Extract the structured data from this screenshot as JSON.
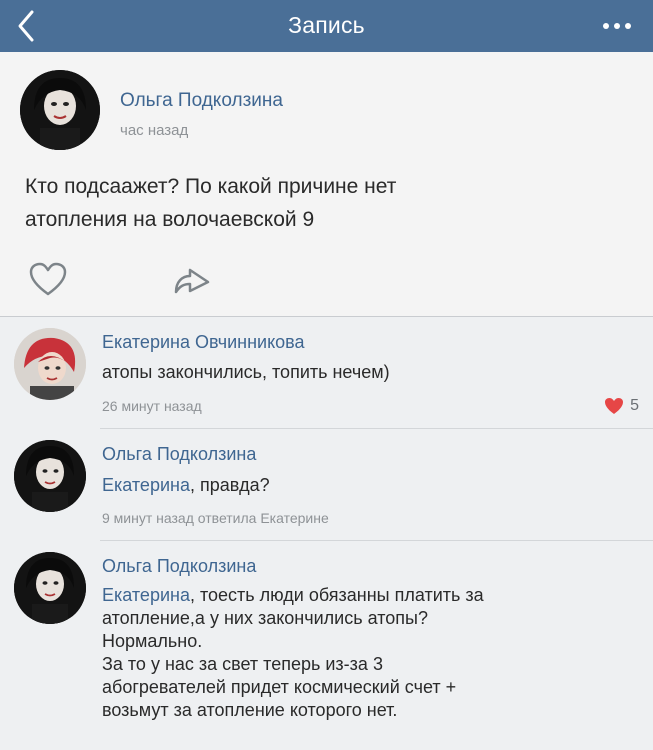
{
  "header": {
    "title": "Запись",
    "back_icon": "chevron-left-icon",
    "menu_icon": "more-horizontal-icon",
    "bar_color": "#4a6f97"
  },
  "post": {
    "author": "Ольга Подколзина",
    "time": "час назад",
    "text_line1": "Кто подсаажет? По какой причине нет",
    "text_line2": "атопления на волочаевской 9",
    "like_icon": "heart-outline-icon",
    "share_icon": "share-icon"
  },
  "comments": [
    {
      "author": "Екатерина Овчинникова",
      "text": "атопы закончились, топить нечем)",
      "time": "26 минут назад",
      "likes": "5",
      "like_color": "#e64646"
    },
    {
      "author": "Ольга Подколзина",
      "mention": "Екатерина",
      "text": ", правда?",
      "time": "9 минут назад ответила Екатерине"
    },
    {
      "author": "Ольга Подколзина",
      "mention": "Екатерина",
      "line1": ", тоесть люди обязанны платить за",
      "line2": "атопление,а у них закончились атопы?",
      "line3": "Нормально.",
      "line4": "За то у нас за свет теперь из-за 3",
      "line5": "абогревателей придет космический счет +",
      "line6": "возьмут за атопление которого нет."
    }
  ]
}
